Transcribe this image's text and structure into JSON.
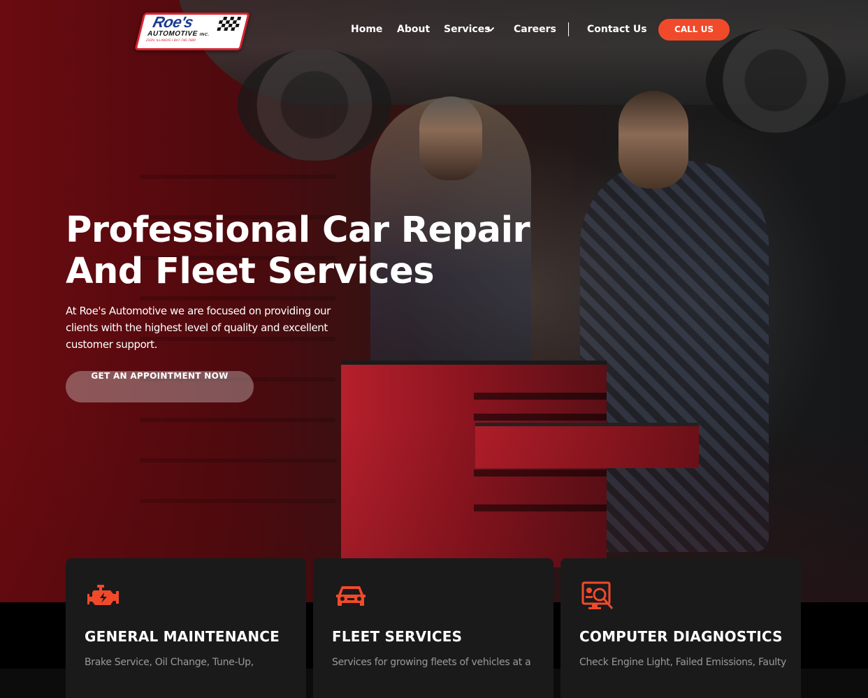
{
  "brand": {
    "logo_word": "Roe's",
    "logo_sub": "AUTOMOTIVE",
    "logo_inc": "INC.",
    "logo_line": "ZION, ILLINOIS • 847-746-7680"
  },
  "nav": {
    "items": [
      {
        "label": "Home"
      },
      {
        "label": "About"
      },
      {
        "label": "Services"
      },
      {
        "label": "Careers"
      },
      {
        "label": "Contact Us"
      }
    ],
    "cta_label": "CALL US"
  },
  "hero": {
    "title_line1": "Professional Car Repair",
    "title_line2": "And Fleet Services",
    "subtitle": "At Roe's Automotive we are focused on providing our clients with the highest level of quality and excellent customer support.",
    "button_label": "GET AN APPOINTMENT NOW"
  },
  "services": [
    {
      "icon": "engine-icon",
      "title": "GENERAL MAINTENANCE",
      "text": "Brake Service, Oil Change, Tune-Up,"
    },
    {
      "icon": "car-icon",
      "title": "FLEET SERVICES",
      "text": "Services for growing fleets of vehicles at a"
    },
    {
      "icon": "diagnostics-icon",
      "title": "COMPUTER DIAGNOSTICS",
      "text": "Check Engine Light, Failed Emissions, Faulty"
    }
  ],
  "colors": {
    "accent": "#f14a2a",
    "hero_red": "#6a0b10",
    "card_bg": "#1a1a1b"
  }
}
